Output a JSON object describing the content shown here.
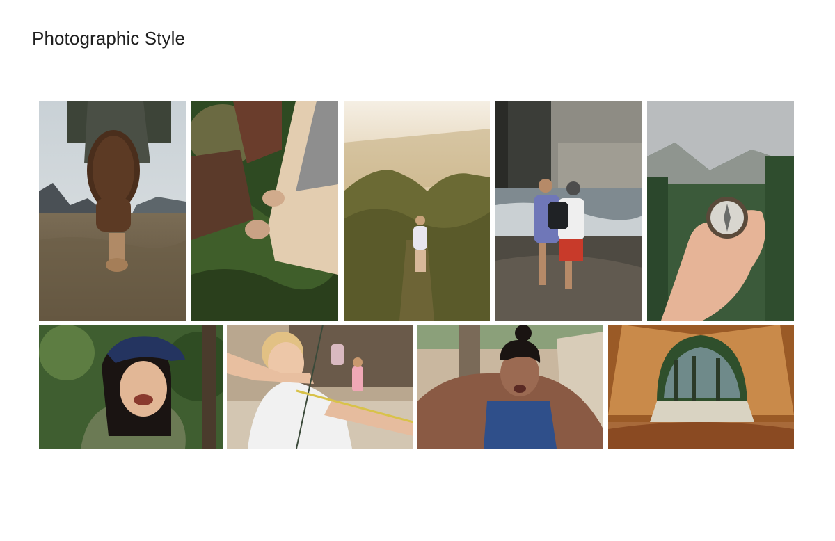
{
  "page": {
    "title": "Photographic Style"
  },
  "gallery": {
    "photos": [
      {
        "subject": "hiking-boot-sole",
        "row": 1
      },
      {
        "subject": "pitching-tent",
        "row": 1
      },
      {
        "subject": "hiker-on-ridge",
        "row": 1
      },
      {
        "subject": "kids-running-beach",
        "row": 1
      },
      {
        "subject": "hand-holding-compass",
        "row": 1
      },
      {
        "subject": "laughing-girl-cap",
        "row": 2
      },
      {
        "subject": "boy-archery",
        "row": 2
      },
      {
        "subject": "girl-obstacle-course",
        "row": 2
      },
      {
        "subject": "tent-view-forest",
        "row": 2
      }
    ]
  }
}
